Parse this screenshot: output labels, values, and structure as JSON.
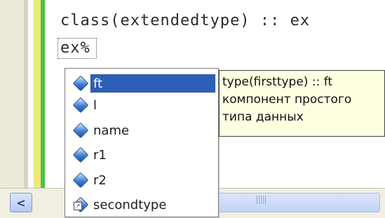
{
  "editor": {
    "lines": [
      "class(extendedtype) :: ex",
      "ex%"
    ]
  },
  "completion": {
    "items": [
      {
        "label": "ft",
        "icon": "member-icon",
        "selected": true
      },
      {
        "label": "l",
        "icon": "member-icon",
        "selected": false
      },
      {
        "label": "name",
        "icon": "member-icon",
        "selected": false
      },
      {
        "label": "r1",
        "icon": "member-icon",
        "selected": false
      },
      {
        "label": "r2",
        "icon": "member-icon",
        "selected": false
      },
      {
        "label": "secondtype",
        "icon": "member-icon",
        "selected": false
      }
    ]
  },
  "tooltip": {
    "lines": [
      "type(firsttype) :: ft",
      "компонент простого",
      "типа данных"
    ]
  },
  "colors": {
    "selection": "#2e5fb8",
    "tooltip_bg": "#ffffe1",
    "change_marker": "#4cc24a",
    "modified_marker": "#eee97a"
  }
}
